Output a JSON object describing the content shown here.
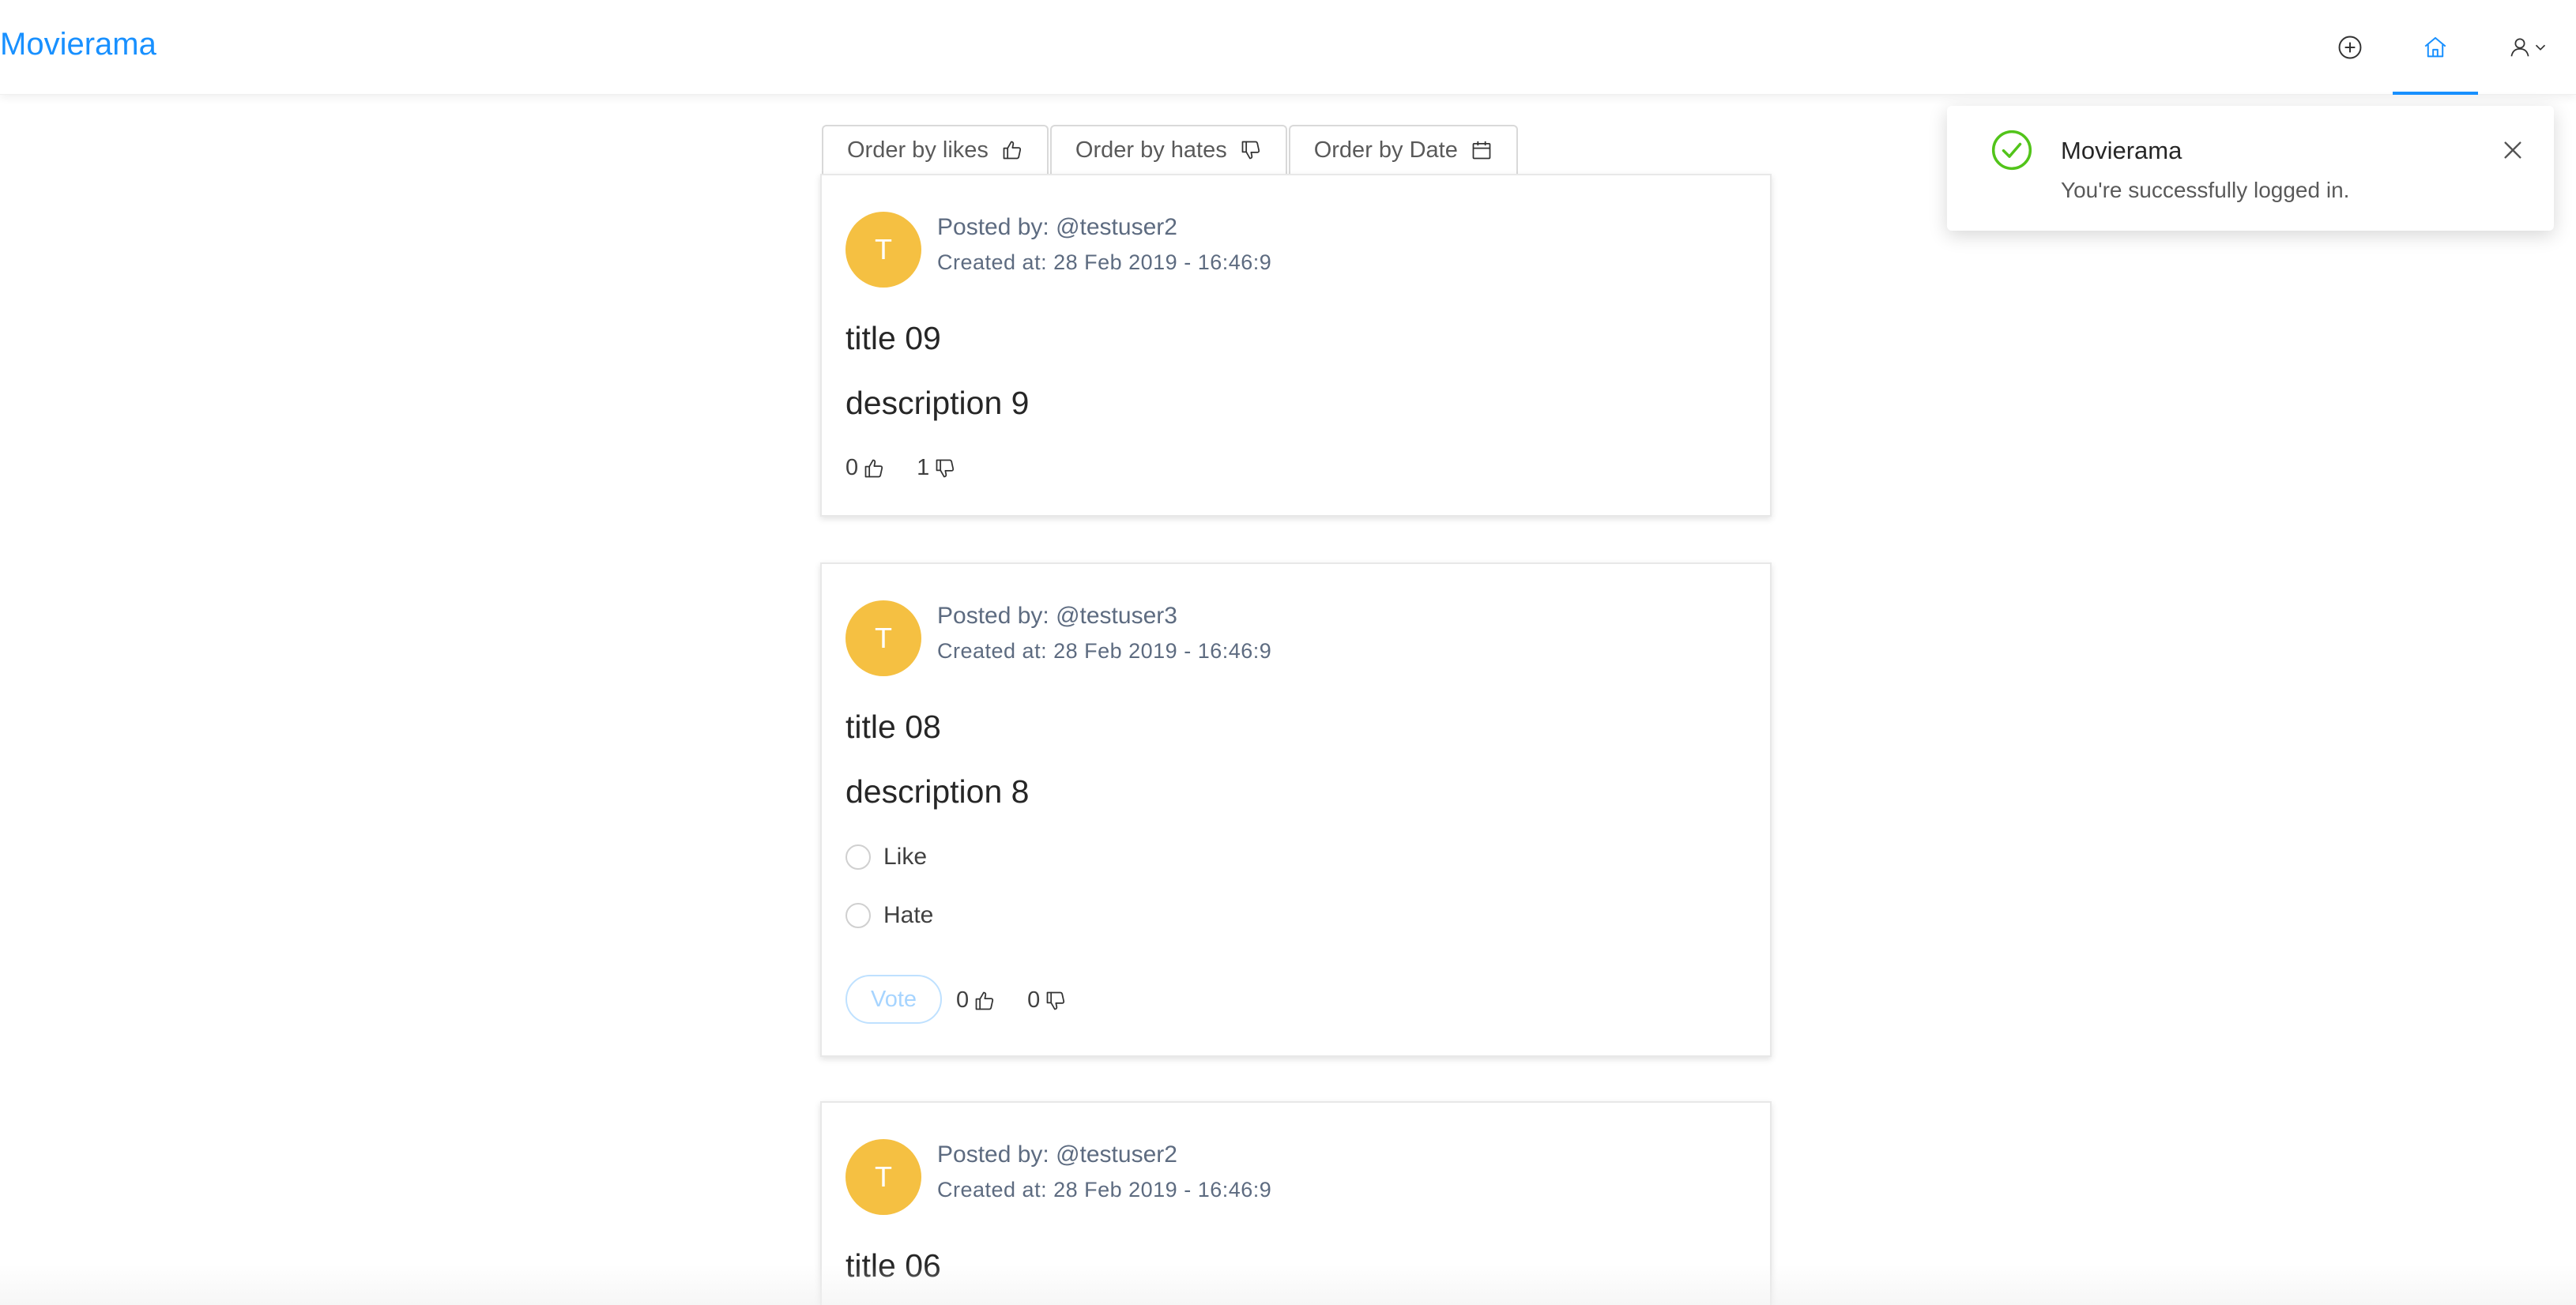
{
  "app": {
    "brand": "Movierama"
  },
  "header": {
    "icons": [
      "add-circle-icon",
      "home-icon",
      "user-icon",
      "chevron-down-icon"
    ]
  },
  "order_bar": {
    "likes_label": "Order by likes",
    "hates_label": "Order by hates",
    "date_label": "Order by Date"
  },
  "posts": [
    {
      "avatar_letter": "T",
      "posted_by": "Posted by: @testuser2",
      "created_at": "Created at: 28 Feb 2019 - 16:46:9",
      "title": "title 09",
      "description": "description 9",
      "likes": "0",
      "hates": "1"
    },
    {
      "avatar_letter": "T",
      "posted_by": "Posted by: @testuser3",
      "created_at": "Created at: 28 Feb 2019 - 16:46:9",
      "title": "title 08",
      "description": "description 8",
      "vote_options": [
        "Like",
        "Hate"
      ],
      "vote_label": "Vote",
      "likes": "0",
      "hates": "0"
    },
    {
      "avatar_letter": "T",
      "posted_by": "Posted by: @testuser2",
      "created_at": "Created at: 28 Feb 2019 - 16:46:9",
      "title": "title 06"
    }
  ],
  "notification": {
    "title": "Movierama",
    "message": "You're successfully logged in.",
    "icon": "check-circle-icon",
    "status_color": "#52c41a"
  },
  "colors": {
    "primary": "#1890ff",
    "avatar": "#f5c042"
  }
}
